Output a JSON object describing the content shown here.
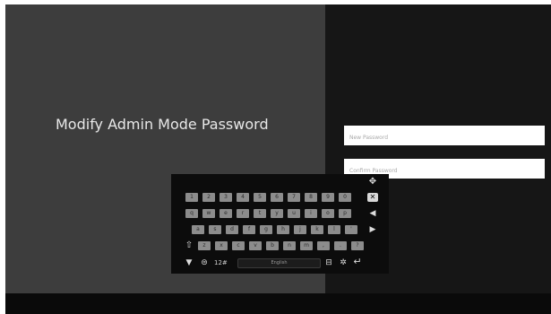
{
  "title": "Modify Admin Mode Password",
  "fields": {
    "new_password_placeholder": "New Password",
    "confirm_password_placeholder": "Confirm Password"
  },
  "keyboard": {
    "row1": [
      "1",
      "2",
      "3",
      "4",
      "5",
      "6",
      "7",
      "8",
      "9",
      "0"
    ],
    "row2": [
      "q",
      "w",
      "e",
      "r",
      "t",
      "y",
      "u",
      "i",
      "o",
      "p"
    ],
    "row3": [
      "a",
      "s",
      "d",
      "f",
      "g",
      "h",
      "j",
      "k",
      "l",
      "'"
    ],
    "row4": [
      "z",
      "x",
      "c",
      "v",
      "b",
      "n",
      "m",
      ",",
      ".",
      "?"
    ],
    "symbols_label": "12#",
    "space_label": "English"
  }
}
